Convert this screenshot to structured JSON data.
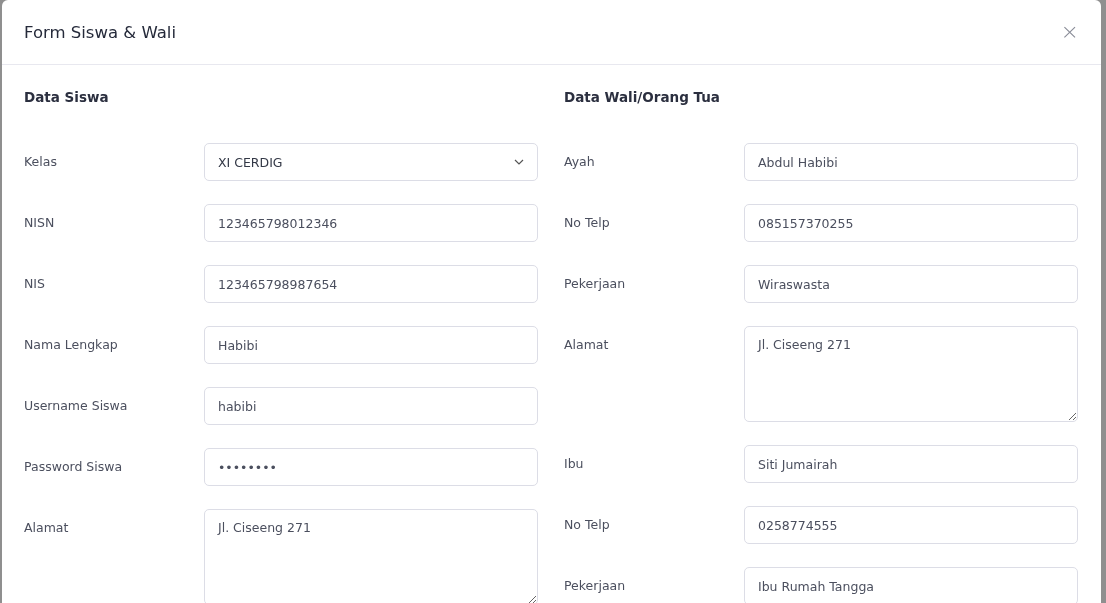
{
  "modal": {
    "title": "Form Siswa & Wali",
    "close": "×"
  },
  "sections": [
    {
      "title": "Data Siswa",
      "fields": [
        {
          "label": "Kelas",
          "kind": "select",
          "value": "XI CERDIG"
        },
        {
          "label": "NISN",
          "kind": "text",
          "value": "123465798012346"
        },
        {
          "label": "NIS",
          "kind": "text",
          "value": "123465798987654"
        },
        {
          "label": "Nama Lengkap",
          "kind": "text",
          "value": "Habibi"
        },
        {
          "label": "Username Siswa",
          "kind": "text",
          "value": "habibi"
        },
        {
          "label": "Password Siswa",
          "kind": "password",
          "value": "••••••••"
        },
        {
          "label": "Alamat",
          "kind": "textarea",
          "value": "Jl. Ciseeng 271"
        }
      ]
    },
    {
      "title": "Data Wali/Orang Tua",
      "fields": [
        {
          "label": "Ayah",
          "kind": "text",
          "value": "Abdul Habibi"
        },
        {
          "label": "No Telp",
          "kind": "text",
          "value": "085157370255"
        },
        {
          "label": "Pekerjaan",
          "kind": "text",
          "value": "Wiraswasta"
        },
        {
          "label": "Alamat",
          "kind": "textarea",
          "value": "Jl. Ciseeng 271"
        },
        {
          "label": "Ibu",
          "kind": "text",
          "value": "Siti Jumairah"
        },
        {
          "label": "No Telp",
          "kind": "text",
          "value": "0258774555"
        },
        {
          "label": "Pekerjaan",
          "kind": "text",
          "value": "Ibu Rumah Tangga"
        }
      ]
    }
  ]
}
